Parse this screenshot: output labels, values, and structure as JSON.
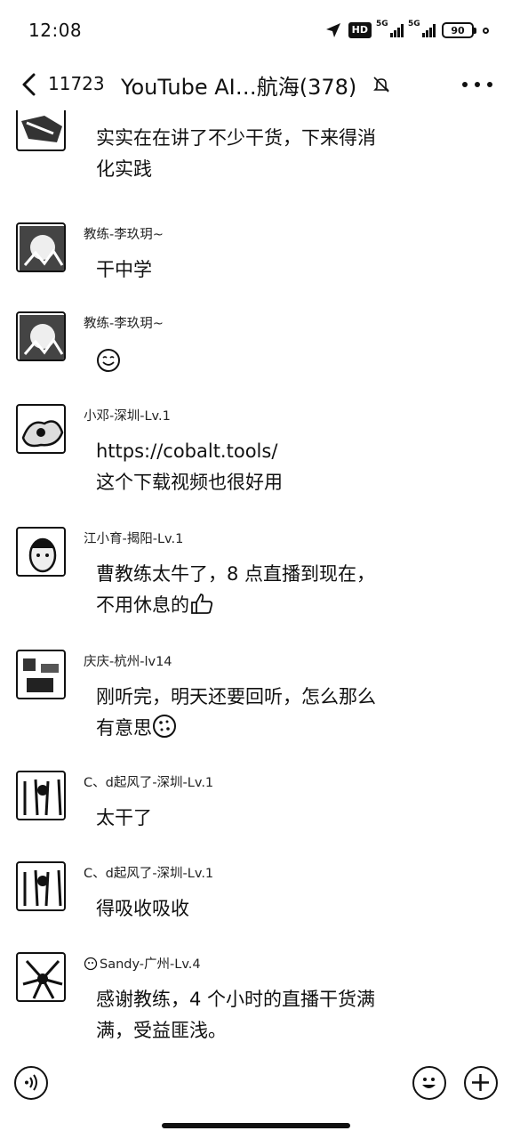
{
  "status_bar": {
    "time": "12:08",
    "hd_label": "HD",
    "net1": "5G",
    "net2": "5G",
    "battery": "90"
  },
  "nav": {
    "back_count": "11723",
    "title": "YouTube AI…航海(378)"
  },
  "messages": [
    {
      "sender": "",
      "lines": [
        "实实在在讲了不少干货，下来得消",
        "化实践"
      ]
    },
    {
      "sender": "教练-李玖玥~",
      "lines": [
        "干中学"
      ]
    },
    {
      "sender": "教练-李玖玥~",
      "lines": [],
      "emoji": "smile-emoji"
    },
    {
      "sender": "小邓-深圳-Lv.1",
      "lines": [
        "https://cobalt.tools/",
        "这个下载视频也很好用"
      ]
    },
    {
      "sender": "江小育-揭阳-Lv.1",
      "lines": [
        "曹教练太牛了，8 点直播到现在，",
        "不用休息的"
      ],
      "emoji": "thumbs-up-emoji"
    },
    {
      "sender": "庆庆-杭州-lv14",
      "lines": [
        "刚听完，明天还要回听，怎么那么",
        "有意思"
      ],
      "emoji": "cookie-emoji"
    },
    {
      "sender": "C、d起风了-深圳-Lv.1",
      "lines": [
        "太干了"
      ]
    },
    {
      "sender": "C、d起风了-深圳-Lv.1",
      "lines": [
        "得吸收吸收"
      ]
    },
    {
      "sender": "Sandy-广州-Lv.4",
      "lines": [
        "感谢教练，4 个小时的直播干货满",
        "满，受益匪浅。"
      ]
    }
  ]
}
